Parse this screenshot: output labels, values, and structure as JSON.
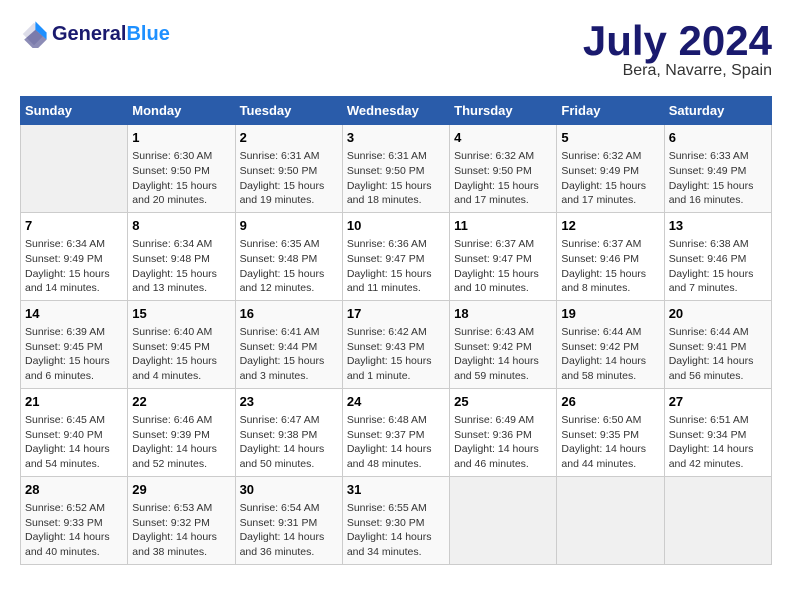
{
  "header": {
    "logo_general": "General",
    "logo_blue": "Blue",
    "month_title": "July 2024",
    "subtitle": "Bera, Navarre, Spain"
  },
  "days_of_week": [
    "Sunday",
    "Monday",
    "Tuesday",
    "Wednesday",
    "Thursday",
    "Friday",
    "Saturday"
  ],
  "weeks": [
    [
      {
        "day": "",
        "content": ""
      },
      {
        "day": "1",
        "content": "Sunrise: 6:30 AM\nSunset: 9:50 PM\nDaylight: 15 hours and 20 minutes."
      },
      {
        "day": "2",
        "content": "Sunrise: 6:31 AM\nSunset: 9:50 PM\nDaylight: 15 hours and 19 minutes."
      },
      {
        "day": "3",
        "content": "Sunrise: 6:31 AM\nSunset: 9:50 PM\nDaylight: 15 hours and 18 minutes."
      },
      {
        "day": "4",
        "content": "Sunrise: 6:32 AM\nSunset: 9:50 PM\nDaylight: 15 hours and 17 minutes."
      },
      {
        "day": "5",
        "content": "Sunrise: 6:32 AM\nSunset: 9:49 PM\nDaylight: 15 hours and 17 minutes."
      },
      {
        "day": "6",
        "content": "Sunrise: 6:33 AM\nSunset: 9:49 PM\nDaylight: 15 hours and 16 minutes."
      }
    ],
    [
      {
        "day": "7",
        "content": "Sunrise: 6:34 AM\nSunset: 9:49 PM\nDaylight: 15 hours and 14 minutes."
      },
      {
        "day": "8",
        "content": "Sunrise: 6:34 AM\nSunset: 9:48 PM\nDaylight: 15 hours and 13 minutes."
      },
      {
        "day": "9",
        "content": "Sunrise: 6:35 AM\nSunset: 9:48 PM\nDaylight: 15 hours and 12 minutes."
      },
      {
        "day": "10",
        "content": "Sunrise: 6:36 AM\nSunset: 9:47 PM\nDaylight: 15 hours and 11 minutes."
      },
      {
        "day": "11",
        "content": "Sunrise: 6:37 AM\nSunset: 9:47 PM\nDaylight: 15 hours and 10 minutes."
      },
      {
        "day": "12",
        "content": "Sunrise: 6:37 AM\nSunset: 9:46 PM\nDaylight: 15 hours and 8 minutes."
      },
      {
        "day": "13",
        "content": "Sunrise: 6:38 AM\nSunset: 9:46 PM\nDaylight: 15 hours and 7 minutes."
      }
    ],
    [
      {
        "day": "14",
        "content": "Sunrise: 6:39 AM\nSunset: 9:45 PM\nDaylight: 15 hours and 6 minutes."
      },
      {
        "day": "15",
        "content": "Sunrise: 6:40 AM\nSunset: 9:45 PM\nDaylight: 15 hours and 4 minutes."
      },
      {
        "day": "16",
        "content": "Sunrise: 6:41 AM\nSunset: 9:44 PM\nDaylight: 15 hours and 3 minutes."
      },
      {
        "day": "17",
        "content": "Sunrise: 6:42 AM\nSunset: 9:43 PM\nDaylight: 15 hours and 1 minute."
      },
      {
        "day": "18",
        "content": "Sunrise: 6:43 AM\nSunset: 9:42 PM\nDaylight: 14 hours and 59 minutes."
      },
      {
        "day": "19",
        "content": "Sunrise: 6:44 AM\nSunset: 9:42 PM\nDaylight: 14 hours and 58 minutes."
      },
      {
        "day": "20",
        "content": "Sunrise: 6:44 AM\nSunset: 9:41 PM\nDaylight: 14 hours and 56 minutes."
      }
    ],
    [
      {
        "day": "21",
        "content": "Sunrise: 6:45 AM\nSunset: 9:40 PM\nDaylight: 14 hours and 54 minutes."
      },
      {
        "day": "22",
        "content": "Sunrise: 6:46 AM\nSunset: 9:39 PM\nDaylight: 14 hours and 52 minutes."
      },
      {
        "day": "23",
        "content": "Sunrise: 6:47 AM\nSunset: 9:38 PM\nDaylight: 14 hours and 50 minutes."
      },
      {
        "day": "24",
        "content": "Sunrise: 6:48 AM\nSunset: 9:37 PM\nDaylight: 14 hours and 48 minutes."
      },
      {
        "day": "25",
        "content": "Sunrise: 6:49 AM\nSunset: 9:36 PM\nDaylight: 14 hours and 46 minutes."
      },
      {
        "day": "26",
        "content": "Sunrise: 6:50 AM\nSunset: 9:35 PM\nDaylight: 14 hours and 44 minutes."
      },
      {
        "day": "27",
        "content": "Sunrise: 6:51 AM\nSunset: 9:34 PM\nDaylight: 14 hours and 42 minutes."
      }
    ],
    [
      {
        "day": "28",
        "content": "Sunrise: 6:52 AM\nSunset: 9:33 PM\nDaylight: 14 hours and 40 minutes."
      },
      {
        "day": "29",
        "content": "Sunrise: 6:53 AM\nSunset: 9:32 PM\nDaylight: 14 hours and 38 minutes."
      },
      {
        "day": "30",
        "content": "Sunrise: 6:54 AM\nSunset: 9:31 PM\nDaylight: 14 hours and 36 minutes."
      },
      {
        "day": "31",
        "content": "Sunrise: 6:55 AM\nSunset: 9:30 PM\nDaylight: 14 hours and 34 minutes."
      },
      {
        "day": "",
        "content": ""
      },
      {
        "day": "",
        "content": ""
      },
      {
        "day": "",
        "content": ""
      }
    ]
  ]
}
